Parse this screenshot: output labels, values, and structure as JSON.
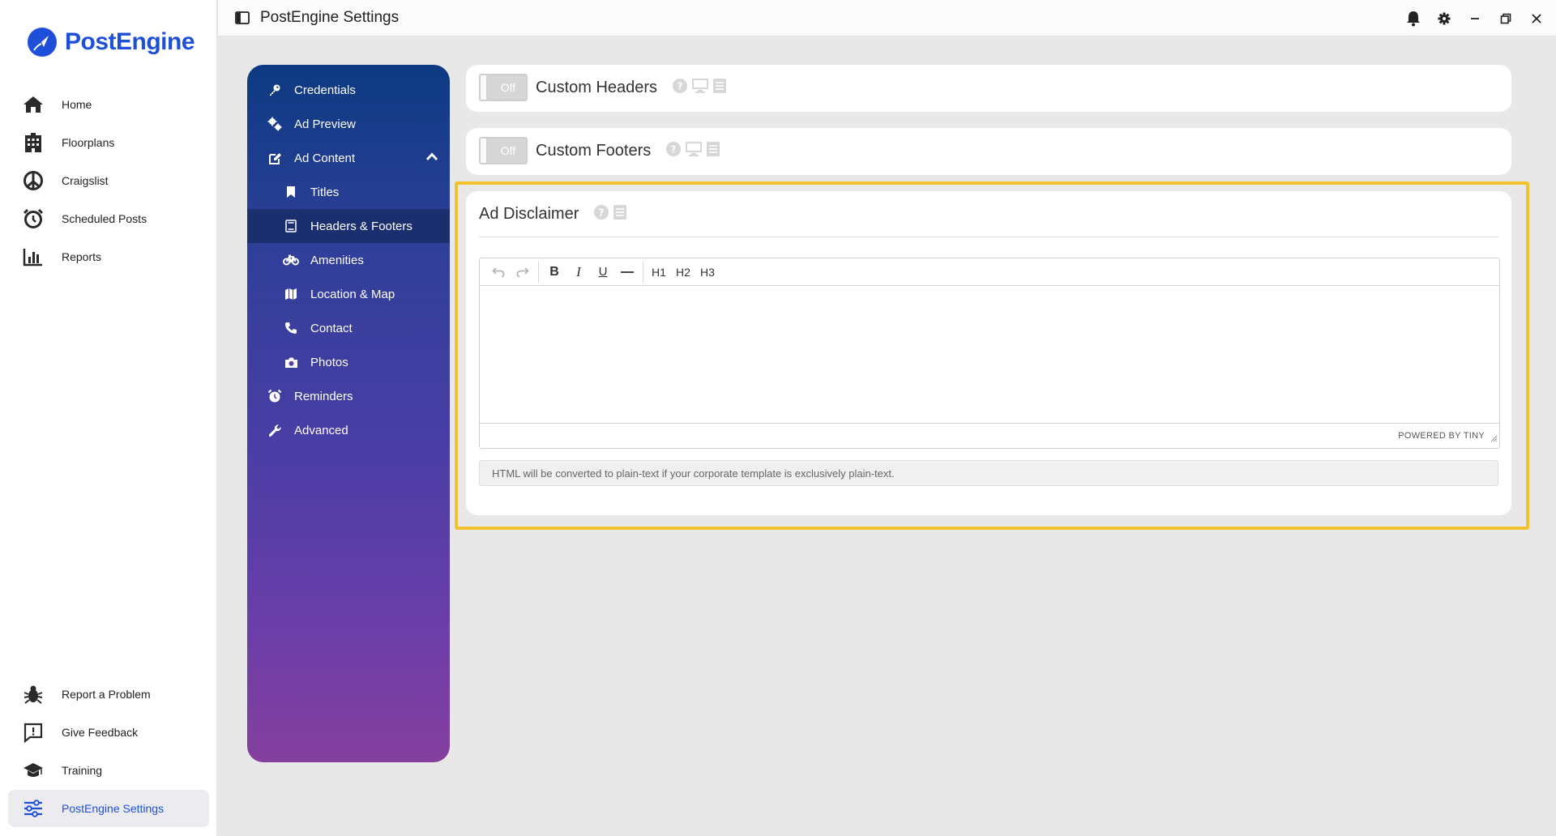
{
  "app": {
    "logo_text": "PostEngine",
    "window_title": "PostEngine Settings",
    "brand_color": "#1e4fd8"
  },
  "sidebar": {
    "items": [
      {
        "label": "Home",
        "icon": "home-icon"
      },
      {
        "label": "Floorplans",
        "icon": "building-icon"
      },
      {
        "label": "Craigslist",
        "icon": "peace-icon"
      },
      {
        "label": "Scheduled Posts",
        "icon": "alarm-clock-icon"
      },
      {
        "label": "Reports",
        "icon": "bar-chart-icon"
      }
    ],
    "bottom_items": [
      {
        "label": "Report a Problem",
        "icon": "bug-icon"
      },
      {
        "label": "Give Feedback",
        "icon": "feedback-icon"
      },
      {
        "label": "Training",
        "icon": "graduation-cap-icon"
      },
      {
        "label": "PostEngine Settings",
        "icon": "sliders-icon",
        "active": true
      }
    ]
  },
  "settings_nav": {
    "items": [
      {
        "label": "Credentials",
        "icon": "key-icon"
      },
      {
        "label": "Ad Preview",
        "icon": "gears-icon"
      },
      {
        "label": "Ad Content",
        "icon": "edit-icon",
        "expanded": true
      },
      {
        "label": "Titles",
        "icon": "bookmark-icon"
      },
      {
        "label": "Headers & Footers",
        "icon": "document-icon",
        "selected": true
      },
      {
        "label": "Amenities",
        "icon": "bicycle-icon"
      },
      {
        "label": "Location & Map",
        "icon": "map-icon"
      },
      {
        "label": "Contact",
        "icon": "phone-icon"
      },
      {
        "label": "Photos",
        "icon": "camera-icon"
      },
      {
        "label": "Reminders",
        "icon": "alarm-clock-icon"
      },
      {
        "label": "Advanced",
        "icon": "wrench-icon"
      }
    ]
  },
  "main": {
    "custom_headers": {
      "toggle_label": "Off",
      "title": "Custom Headers"
    },
    "custom_footers": {
      "toggle_label": "Off",
      "title": "Custom Footers"
    },
    "ad_disclaimer": {
      "title": "Ad Disclaimer",
      "toolbar": {
        "h1": "H1",
        "h2": "H2",
        "h3": "H3",
        "bold": "B",
        "italic": "I",
        "underline": "U"
      },
      "powered_by": "POWERED BY TINY",
      "note": "HTML will be converted to plain-text if your corporate template is exclusively plain-text."
    }
  },
  "colors": {
    "highlight": "#f2c12e",
    "gradient_top": "#0c3a82",
    "gradient_bottom": "#853f9f"
  }
}
